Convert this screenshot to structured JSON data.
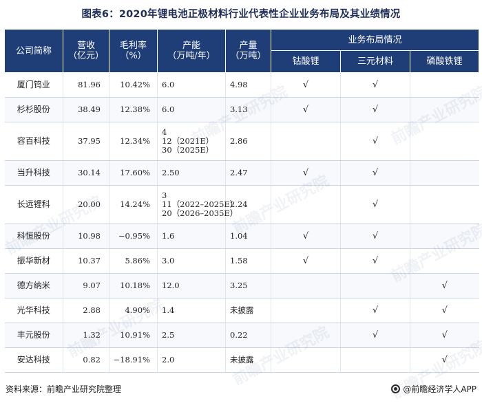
{
  "title": "图表6：2020年锂电池正极材料行业代表性企业业务布局及其业绩情况",
  "headers": {
    "company": "公司简称",
    "revenue_1": "营收",
    "revenue_2": "（亿元）",
    "margin_1": "毛利率",
    "margin_2": "（%）",
    "capacity_1": "产能",
    "capacity_2": "（万吨/年）",
    "output_1": "产量",
    "output_2": "（万吨）",
    "business": "业务布局情况",
    "lco": "钴酸锂",
    "ncm": "三元材料",
    "lfp": "磷酸铁锂"
  },
  "check_mark": "√",
  "rows": [
    {
      "name": "厦门钨业",
      "revenue": "81.96",
      "margin": "10.42%",
      "capacity": [
        "6.0"
      ],
      "output": "4.98",
      "lco": "√",
      "ncm": "√",
      "lfp": ""
    },
    {
      "name": "杉杉股份",
      "revenue": "38.49",
      "margin": "12.38%",
      "capacity": [
        "6.0"
      ],
      "output": "3.13",
      "lco": "√",
      "ncm": "√",
      "lfp": ""
    },
    {
      "name": "容百科技",
      "revenue": "37.95",
      "margin": "12.34%",
      "capacity": [
        "4",
        "12（2021E）",
        "30（2025E）"
      ],
      "output": "2.86",
      "lco": "",
      "ncm": "√",
      "lfp": ""
    },
    {
      "name": "当升科技",
      "revenue": "30.14",
      "margin": "17.60%",
      "capacity": [
        "2.50"
      ],
      "output": "2.47",
      "lco": "√",
      "ncm": "√",
      "lfp": ""
    },
    {
      "name": "长远锂科",
      "revenue": "20.00",
      "margin": "14.24%",
      "capacity": [
        "3",
        "11（2022–2025E）",
        "20（2026–2035E）"
      ],
      "output": "2.24",
      "lco": "",
      "ncm": "√",
      "lfp": ""
    },
    {
      "name": "科恒股份",
      "revenue": "10.98",
      "margin": "−0.95%",
      "capacity": [
        "1.6"
      ],
      "output": "1.04",
      "lco": "√",
      "ncm": "√",
      "lfp": ""
    },
    {
      "name": "振华新材",
      "revenue": "10.37",
      "margin": "5.86%",
      "capacity": [
        "3.0"
      ],
      "output": "1.58",
      "lco": "√",
      "ncm": "√",
      "lfp": ""
    },
    {
      "name": "德方纳米",
      "revenue": "9.07",
      "margin": "10.18%",
      "capacity": [
        "12.0"
      ],
      "output": "3.25",
      "lco": "",
      "ncm": "",
      "lfp": "√"
    },
    {
      "name": "光华科技",
      "revenue": "2.88",
      "margin": "4.90%",
      "capacity": [
        "1.4"
      ],
      "output": "未披露",
      "lco": "",
      "ncm": "√",
      "lfp": "√"
    },
    {
      "name": "丰元股份",
      "revenue": "1.32",
      "margin": "10.91%",
      "capacity": [
        "2.5"
      ],
      "output": "0.22",
      "lco": "",
      "ncm": "√",
      "lfp": "√"
    },
    {
      "name": "安达科技",
      "revenue": "0.82",
      "margin": "−18.91%",
      "capacity": [
        "2.0"
      ],
      "output": "未披露",
      "lco": "",
      "ncm": "",
      "lfp": "√"
    }
  ],
  "footer": {
    "source": "资料来源：前瞻产业研究院整理",
    "brand": "@前瞻经济学人APP",
    "brand_icon": "circle-logo-icon"
  }
}
